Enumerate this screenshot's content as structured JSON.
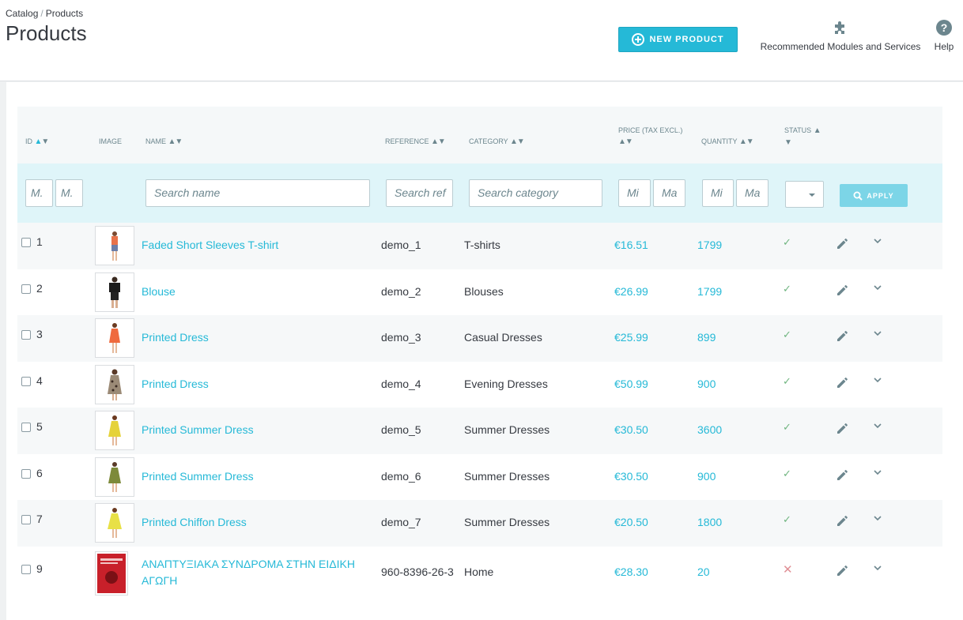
{
  "breadcrumb": {
    "parent": "Catalog",
    "current": "Products"
  },
  "page_title": "Products",
  "toolbar": {
    "new_product_label": "New product",
    "modules_label": "Recommended Modules and Services",
    "help_label": "Help"
  },
  "colors": {
    "accent": "#25b9d7",
    "status_enabled": "#70b580",
    "status_disabled": "#e08f95"
  },
  "table": {
    "headers": {
      "id": "ID",
      "image": "Image",
      "name": "Name",
      "reference": "Reference",
      "category": "Category",
      "price": "Price (tax excl.)",
      "quantity": "Quantity",
      "status": "Status"
    },
    "filters": {
      "id_min": "M.",
      "id_max": "M.",
      "name_placeholder": "Search name",
      "reference_placeholder": "Search ref",
      "category_placeholder": "Search category",
      "price_min": "Mi",
      "price_max": "Ma",
      "qty_min": "Mi",
      "qty_max": "Ma",
      "apply_label": "Apply"
    },
    "rows": [
      {
        "id": "1",
        "name": "Faded Short Sleeves T-shirt",
        "reference": "demo_1",
        "category": "T-shirts",
        "price": "€16.51",
        "quantity": "1799",
        "status": "enabled",
        "image": "orange-tshirt"
      },
      {
        "id": "2",
        "name": "Blouse",
        "reference": "demo_2",
        "category": "Blouses",
        "price": "€26.99",
        "quantity": "1799",
        "status": "enabled",
        "image": "black-blouse"
      },
      {
        "id": "3",
        "name": "Printed Dress",
        "reference": "demo_3",
        "category": "Casual Dresses",
        "price": "€25.99",
        "quantity": "899",
        "status": "enabled",
        "image": "orange-dress"
      },
      {
        "id": "4",
        "name": "Printed Dress",
        "reference": "demo_4",
        "category": "Evening Dresses",
        "price": "€50.99",
        "quantity": "900",
        "status": "enabled",
        "image": "patterned-dress"
      },
      {
        "id": "5",
        "name": "Printed Summer Dress",
        "reference": "demo_5",
        "category": "Summer Dresses",
        "price": "€30.50",
        "quantity": "3600",
        "status": "enabled",
        "image": "yellow-dress"
      },
      {
        "id": "6",
        "name": "Printed Summer Dress",
        "reference": "demo_6",
        "category": "Summer Dresses",
        "price": "€30.50",
        "quantity": "900",
        "status": "enabled",
        "image": "green-dress"
      },
      {
        "id": "7",
        "name": "Printed Chiffon Dress",
        "reference": "demo_7",
        "category": "Summer Dresses",
        "price": "€20.50",
        "quantity": "1800",
        "status": "enabled",
        "image": "yellow-chiffon"
      },
      {
        "id": "9",
        "name_line1": "ΑΝΑΠΤΥΞΙΑΚΑ ΣΥΝΔΡΟΜΑ ΣΤΗΝ ΕΙΔΙΚΗ",
        "name_line2": "ΑΓΩΓΗ",
        "reference": "960-8396-26-3",
        "category": "Home",
        "price": "€28.30",
        "quantity": "20",
        "status": "disabled",
        "image": "red-book"
      }
    ]
  }
}
